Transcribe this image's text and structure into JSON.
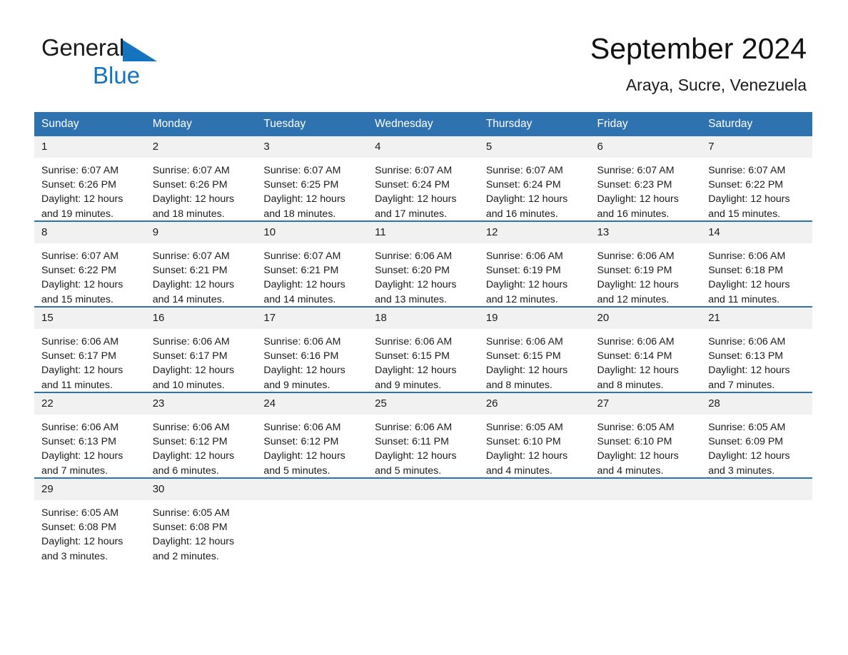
{
  "brand": {
    "name_part1": "General",
    "name_part2": "Blue",
    "triangle_color": "#1574bf"
  },
  "header": {
    "month_title": "September 2024",
    "location": "Araya, Sucre, Venezuela"
  },
  "theme": {
    "header_blue": "#2e72b0",
    "daynum_band": "#f1f1f1",
    "text": "#1b1b1b",
    "page_background": "#ffffff"
  },
  "calendar": {
    "weekday_headers": [
      "Sunday",
      "Monday",
      "Tuesday",
      "Wednesday",
      "Thursday",
      "Friday",
      "Saturday"
    ],
    "weeks": [
      [
        {
          "day": "1",
          "sunrise": "Sunrise: 6:07 AM",
          "sunset": "Sunset: 6:26 PM",
          "daylight_line1": "Daylight: 12 hours",
          "daylight_line2": "and 19 minutes."
        },
        {
          "day": "2",
          "sunrise": "Sunrise: 6:07 AM",
          "sunset": "Sunset: 6:26 PM",
          "daylight_line1": "Daylight: 12 hours",
          "daylight_line2": "and 18 minutes."
        },
        {
          "day": "3",
          "sunrise": "Sunrise: 6:07 AM",
          "sunset": "Sunset: 6:25 PM",
          "daylight_line1": "Daylight: 12 hours",
          "daylight_line2": "and 18 minutes."
        },
        {
          "day": "4",
          "sunrise": "Sunrise: 6:07 AM",
          "sunset": "Sunset: 6:24 PM",
          "daylight_line1": "Daylight: 12 hours",
          "daylight_line2": "and 17 minutes."
        },
        {
          "day": "5",
          "sunrise": "Sunrise: 6:07 AM",
          "sunset": "Sunset: 6:24 PM",
          "daylight_line1": "Daylight: 12 hours",
          "daylight_line2": "and 16 minutes."
        },
        {
          "day": "6",
          "sunrise": "Sunrise: 6:07 AM",
          "sunset": "Sunset: 6:23 PM",
          "daylight_line1": "Daylight: 12 hours",
          "daylight_line2": "and 16 minutes."
        },
        {
          "day": "7",
          "sunrise": "Sunrise: 6:07 AM",
          "sunset": "Sunset: 6:22 PM",
          "daylight_line1": "Daylight: 12 hours",
          "daylight_line2": "and 15 minutes."
        }
      ],
      [
        {
          "day": "8",
          "sunrise": "Sunrise: 6:07 AM",
          "sunset": "Sunset: 6:22 PM",
          "daylight_line1": "Daylight: 12 hours",
          "daylight_line2": "and 15 minutes."
        },
        {
          "day": "9",
          "sunrise": "Sunrise: 6:07 AM",
          "sunset": "Sunset: 6:21 PM",
          "daylight_line1": "Daylight: 12 hours",
          "daylight_line2": "and 14 minutes."
        },
        {
          "day": "10",
          "sunrise": "Sunrise: 6:07 AM",
          "sunset": "Sunset: 6:21 PM",
          "daylight_line1": "Daylight: 12 hours",
          "daylight_line2": "and 14 minutes."
        },
        {
          "day": "11",
          "sunrise": "Sunrise: 6:06 AM",
          "sunset": "Sunset: 6:20 PM",
          "daylight_line1": "Daylight: 12 hours",
          "daylight_line2": "and 13 minutes."
        },
        {
          "day": "12",
          "sunrise": "Sunrise: 6:06 AM",
          "sunset": "Sunset: 6:19 PM",
          "daylight_line1": "Daylight: 12 hours",
          "daylight_line2": "and 12 minutes."
        },
        {
          "day": "13",
          "sunrise": "Sunrise: 6:06 AM",
          "sunset": "Sunset: 6:19 PM",
          "daylight_line1": "Daylight: 12 hours",
          "daylight_line2": "and 12 minutes."
        },
        {
          "day": "14",
          "sunrise": "Sunrise: 6:06 AM",
          "sunset": "Sunset: 6:18 PM",
          "daylight_line1": "Daylight: 12 hours",
          "daylight_line2": "and 11 minutes."
        }
      ],
      [
        {
          "day": "15",
          "sunrise": "Sunrise: 6:06 AM",
          "sunset": "Sunset: 6:17 PM",
          "daylight_line1": "Daylight: 12 hours",
          "daylight_line2": "and 11 minutes."
        },
        {
          "day": "16",
          "sunrise": "Sunrise: 6:06 AM",
          "sunset": "Sunset: 6:17 PM",
          "daylight_line1": "Daylight: 12 hours",
          "daylight_line2": "and 10 minutes."
        },
        {
          "day": "17",
          "sunrise": "Sunrise: 6:06 AM",
          "sunset": "Sunset: 6:16 PM",
          "daylight_line1": "Daylight: 12 hours",
          "daylight_line2": "and 9 minutes."
        },
        {
          "day": "18",
          "sunrise": "Sunrise: 6:06 AM",
          "sunset": "Sunset: 6:15 PM",
          "daylight_line1": "Daylight: 12 hours",
          "daylight_line2": "and 9 minutes."
        },
        {
          "day": "19",
          "sunrise": "Sunrise: 6:06 AM",
          "sunset": "Sunset: 6:15 PM",
          "daylight_line1": "Daylight: 12 hours",
          "daylight_line2": "and 8 minutes."
        },
        {
          "day": "20",
          "sunrise": "Sunrise: 6:06 AM",
          "sunset": "Sunset: 6:14 PM",
          "daylight_line1": "Daylight: 12 hours",
          "daylight_line2": "and 8 minutes."
        },
        {
          "day": "21",
          "sunrise": "Sunrise: 6:06 AM",
          "sunset": "Sunset: 6:13 PM",
          "daylight_line1": "Daylight: 12 hours",
          "daylight_line2": "and 7 minutes."
        }
      ],
      [
        {
          "day": "22",
          "sunrise": "Sunrise: 6:06 AM",
          "sunset": "Sunset: 6:13 PM",
          "daylight_line1": "Daylight: 12 hours",
          "daylight_line2": "and 7 minutes."
        },
        {
          "day": "23",
          "sunrise": "Sunrise: 6:06 AM",
          "sunset": "Sunset: 6:12 PM",
          "daylight_line1": "Daylight: 12 hours",
          "daylight_line2": "and 6 minutes."
        },
        {
          "day": "24",
          "sunrise": "Sunrise: 6:06 AM",
          "sunset": "Sunset: 6:12 PM",
          "daylight_line1": "Daylight: 12 hours",
          "daylight_line2": "and 5 minutes."
        },
        {
          "day": "25",
          "sunrise": "Sunrise: 6:06 AM",
          "sunset": "Sunset: 6:11 PM",
          "daylight_line1": "Daylight: 12 hours",
          "daylight_line2": "and 5 minutes."
        },
        {
          "day": "26",
          "sunrise": "Sunrise: 6:05 AM",
          "sunset": "Sunset: 6:10 PM",
          "daylight_line1": "Daylight: 12 hours",
          "daylight_line2": "and 4 minutes."
        },
        {
          "day": "27",
          "sunrise": "Sunrise: 6:05 AM",
          "sunset": "Sunset: 6:10 PM",
          "daylight_line1": "Daylight: 12 hours",
          "daylight_line2": "and 4 minutes."
        },
        {
          "day": "28",
          "sunrise": "Sunrise: 6:05 AM",
          "sunset": "Sunset: 6:09 PM",
          "daylight_line1": "Daylight: 12 hours",
          "daylight_line2": "and 3 minutes."
        }
      ],
      [
        {
          "day": "29",
          "sunrise": "Sunrise: 6:05 AM",
          "sunset": "Sunset: 6:08 PM",
          "daylight_line1": "Daylight: 12 hours",
          "daylight_line2": "and 3 minutes."
        },
        {
          "day": "30",
          "sunrise": "Sunrise: 6:05 AM",
          "sunset": "Sunset: 6:08 PM",
          "daylight_line1": "Daylight: 12 hours",
          "daylight_line2": "and 2 minutes."
        },
        {
          "day": "",
          "sunrise": "",
          "sunset": "",
          "daylight_line1": "",
          "daylight_line2": "",
          "empty": true
        },
        {
          "day": "",
          "sunrise": "",
          "sunset": "",
          "daylight_line1": "",
          "daylight_line2": "",
          "empty": true
        },
        {
          "day": "",
          "sunrise": "",
          "sunset": "",
          "daylight_line1": "",
          "daylight_line2": "",
          "empty": true
        },
        {
          "day": "",
          "sunrise": "",
          "sunset": "",
          "daylight_line1": "",
          "daylight_line2": "",
          "empty": true
        },
        {
          "day": "",
          "sunrise": "",
          "sunset": "",
          "daylight_line1": "",
          "daylight_line2": "",
          "empty": true
        }
      ]
    ]
  }
}
